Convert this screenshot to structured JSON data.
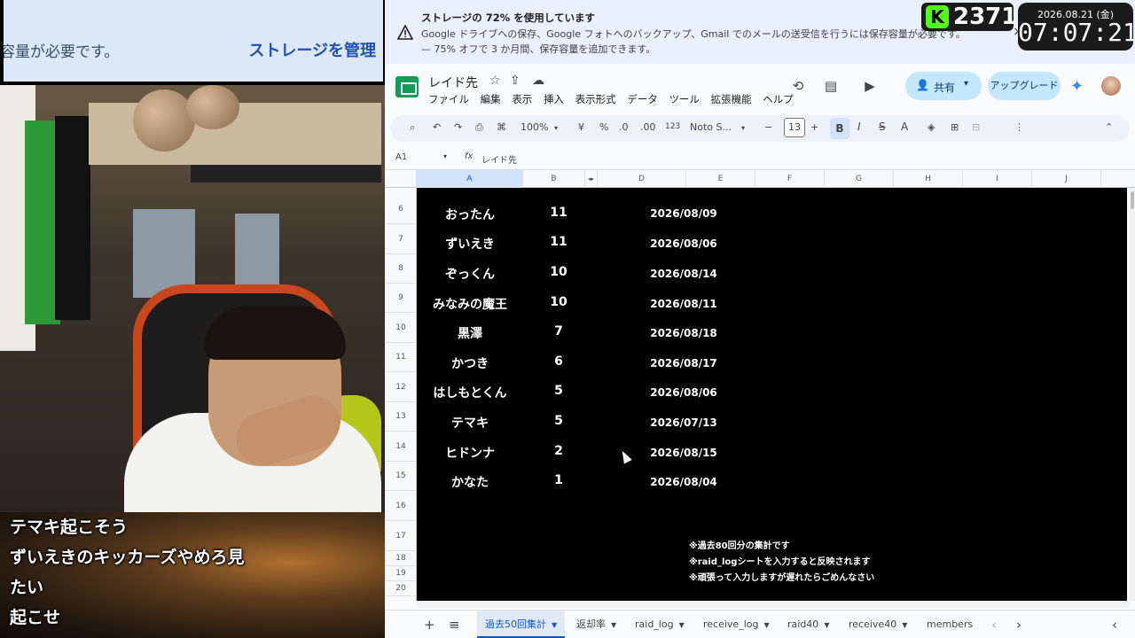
{
  "overlay_left": {
    "left_text": "容量が必要です。",
    "right_text": "ストレージを管理"
  },
  "chat": {
    "messages": [
      "テマキ起こそう",
      "ずいえきのキッカーズやめろ見",
      "たい",
      "起こせ"
    ]
  },
  "stream": {
    "counter_value": "2371",
    "k_logo": "K",
    "date": "2026.08.21 (金)",
    "time": "07:07:21"
  },
  "banner": {
    "title": "ストレージの 72% を使用しています",
    "line2": "Google ドライブへの保存、Google フォトへのバックアップ、Gmail でのメールの送受信を行うには保存容量が必要です。",
    "line3": "— 75% オフで 3 か月間、保存容量を追加できます。",
    "close": "×"
  },
  "doc": {
    "title": "レイド先",
    "menus": [
      "ファイル",
      "編集",
      "表示",
      "挿入",
      "表示形式",
      "データ",
      "ツール",
      "拡張機能",
      "ヘルプ"
    ],
    "share_label": "共有",
    "upgrade_label": "アップグレード"
  },
  "toolbar": {
    "zoom": "100%",
    "currency": "¥",
    "percent": "%",
    "dec_minus": ".0",
    "dec_plus": ".00",
    "format_123": "123",
    "font": "Noto S...",
    "font_size": "13",
    "bold": "B",
    "italic": "I",
    "strike": "S",
    "textcolor": "A"
  },
  "formula": {
    "namebox": "A1",
    "fx": "fx",
    "value": "レイド先"
  },
  "columns": [
    "A",
    "B",
    "D",
    "E",
    "F",
    "G",
    "H",
    "I",
    "J"
  ],
  "row_numbers": [
    "6",
    "7",
    "8",
    "9",
    "10",
    "11",
    "12",
    "13",
    "14",
    "15",
    "16",
    "17",
    "18",
    "19",
    "20"
  ],
  "table": [
    {
      "name": "おったん",
      "count": "11",
      "date": "2026/08/09"
    },
    {
      "name": "ずいえき",
      "count": "11",
      "date": "2026/08/06"
    },
    {
      "name": "ぞっくん",
      "count": "10",
      "date": "2026/08/14"
    },
    {
      "name": "みなみの魔王",
      "count": "10",
      "date": "2026/08/11"
    },
    {
      "name": "黒澤",
      "count": "7",
      "date": "2026/08/18"
    },
    {
      "name": "かつき",
      "count": "6",
      "date": "2026/08/17"
    },
    {
      "name": "はしもとくん",
      "count": "5",
      "date": "2026/08/06"
    },
    {
      "name": "テマキ",
      "count": "5",
      "date": "2026/07/13"
    },
    {
      "name": "ヒドンナ",
      "count": "2",
      "date": "2026/08/15"
    },
    {
      "name": "かなた",
      "count": "1",
      "date": "2026/08/04"
    }
  ],
  "notes": [
    "※過去80回分の集計です",
    "※raid_logシートを入力すると反映されます",
    "※頑張って入力しますが遅れたらごめんなさい"
  ],
  "tabs": [
    {
      "label": "過去50回集計",
      "active": true
    },
    {
      "label": "返却率"
    },
    {
      "label": "raid_log"
    },
    {
      "label": "receive_log"
    },
    {
      "label": "raid40"
    },
    {
      "label": "receive40"
    },
    {
      "label": "members"
    }
  ],
  "tabbar": {
    "add": "+",
    "list": "≡",
    "prev": "‹",
    "next": "›"
  },
  "colors": {
    "accent": "#0b57d0",
    "sheets_green": "#0f9d58",
    "kick_green": "#53fc18"
  }
}
